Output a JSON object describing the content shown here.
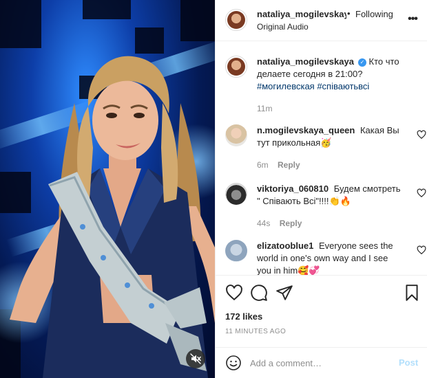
{
  "header": {
    "username": "nataliya_mogilevskaya",
    "separator": "•",
    "follow_status": "Following",
    "audio_label": "Original Audio",
    "more_icon": "more-horizontal-icon"
  },
  "caption": {
    "username": "nataliya_mogilevskaya",
    "verified": true,
    "text": "Кто что делаете сегодня в 21:00?",
    "hashtags": "#могилевская #співаютьвсі",
    "age": "11m"
  },
  "comments": [
    {
      "username": "n.mogilevskaya_queen",
      "text": "Какая Вы тут прикольная🥳",
      "age": "6m",
      "reply_label": "Reply"
    },
    {
      "username": "viktoriya_060810",
      "text": "Будем смотреть \" Співають Всі\"!!!!👏🔥",
      "age": "44s",
      "reply_label": "Reply"
    },
    {
      "username": "elizatooblue1",
      "text": "Everyone sees the world in one's own way and I see you in him🥰💞",
      "age": "",
      "reply_label": ""
    }
  ],
  "actions": {
    "like_icon": "heart-icon",
    "comment_icon": "comment-icon",
    "share_icon": "paper-plane-icon",
    "save_icon": "bookmark-icon"
  },
  "likes": "172 likes",
  "timestamp": "11 MINUTES AGO",
  "composer": {
    "placeholder": "Add a comment…",
    "post_label": "Post"
  },
  "media": {
    "mute_icon": "speaker-muted-icon"
  },
  "colors": {
    "link": "#00376b",
    "verified": "#3897f0",
    "post_disabled": "#b2dffc",
    "muted_text": "#8e8e8e",
    "video_blue": "#0d3ea8"
  }
}
